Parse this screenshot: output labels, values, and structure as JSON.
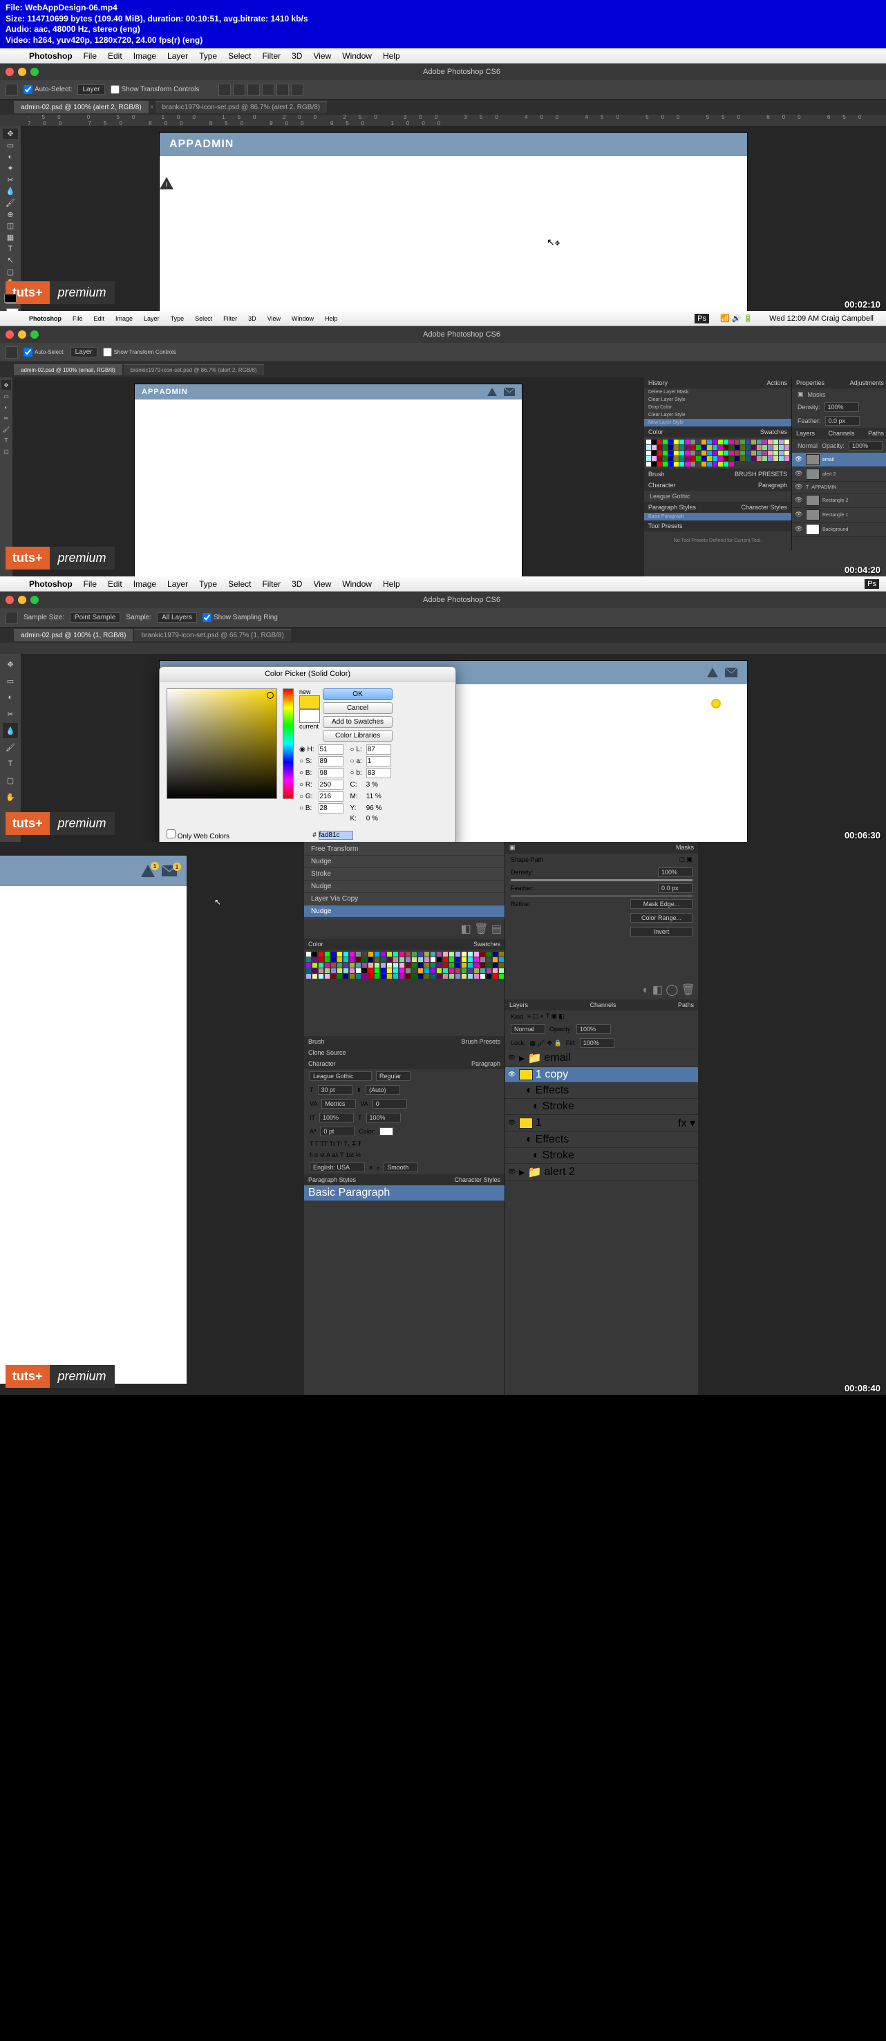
{
  "info": {
    "file": "File: WebAppDesign-06.mp4",
    "size": "Size: 114710699 bytes (109.40 MiB), duration: 00:10:51, avg.bitrate: 1410 kb/s",
    "audio": "Audio: aac, 48000 Hz, stereo (eng)",
    "video": "Video: h264, yuv420p, 1280x720, 24.00 fps(r) (eng)"
  },
  "menu": {
    "apple": "",
    "app": "Photoshop",
    "items": [
      "File",
      "Edit",
      "Image",
      "Layer",
      "Type",
      "Select",
      "Filter",
      "3D",
      "View",
      "Window",
      "Help"
    ],
    "status_right": "Wed 12:09 AM   Craig Campbell",
    "ps_badge": "Ps"
  },
  "title_bar": "Adobe Photoshop CS6",
  "options": {
    "auto_select": "Auto-Select:",
    "layer_sel": "Layer",
    "show_transform": "Show Transform Controls",
    "sample_size": "Sample Size:",
    "point_sample": "Point Sample",
    "sample": "Sample:",
    "all_layers": "All Layers",
    "show_ring": "Show Sampling Ring"
  },
  "tabs": {
    "t1_a": "admin-02.psd @ 100% (alert 2, RGB/8)",
    "t1_b": "brankic1979-icon-set.psd @ 86.7% (alert 2, RGB/8)",
    "t2_a": "admin-02.psd @ 100% (email, RGB/8)",
    "t2_b": "brankic1979-icon-set.psd @ 86.7% (alert 2, RGB/8)",
    "t3_a": "admin-02.psd @ 100% (1, RGB/8)",
    "t3_b": "brankic1979-icon-set.psd @ 66.7% (1, RGB/8)"
  },
  "app_header": {
    "logo_bold": "APP",
    "logo_thin": "ADMIN"
  },
  "color_picker": {
    "title": "Color Picker (Solid Color)",
    "ok": "OK",
    "cancel": "Cancel",
    "add_swatch": "Add to Swatches",
    "color_libs": "Color Libraries",
    "new": "new",
    "current": "current",
    "only_web": "Only Web Colors",
    "h": "51",
    "s": "89",
    "b": "98",
    "r": "250",
    "g": "216",
    "bb": "28",
    "l": "87",
    "a": "1",
    "bl": "83",
    "c": "3",
    "m": "11",
    "y": "96",
    "k": "0",
    "hex": "fad81c"
  },
  "panels": {
    "history": "History",
    "actions": "Actions",
    "swatches": "Swatches",
    "color": "Color",
    "character": "Character",
    "paragraph": "Paragraph",
    "par_styles": "Paragraph Styles",
    "char_styles": "Character Styles",
    "basic_par": "Basic Paragraph",
    "brush": "Brush",
    "brush_presets": "Brush Presets",
    "clone_src": "Clone Source",
    "properties": "Properties",
    "adjustments": "Adjustments",
    "layers": "Layers",
    "channels": "Channels",
    "paths": "Paths",
    "masks": "Masks",
    "shape_path": "Shape Path",
    "density": "Density:",
    "density_val": "100%",
    "feather": "Feather:",
    "feather_val": "0.0 px",
    "refine": "Refine:",
    "mask_edge": "Mask Edge...",
    "color_range": "Color Range...",
    "invert": "Invert",
    "normal": "Normal",
    "opacity": "Opacity:",
    "opacity_val": "100%",
    "lock": "Lock:",
    "fill": "Fill:",
    "fill_val": "100%",
    "kind": "Kind",
    "tool_presets": "Tool Presets",
    "no_presets": "No Tool Presets Defined for Current Tool.",
    "h_items": [
      "Delete Layer Mask",
      "Clear Layer Style",
      "Drop Color",
      "Clear Layer Style",
      "New Layer Style"
    ],
    "brush_preset_label": "BRUSH PRESETS",
    "league_gothic": "League Gothic",
    "regular": "Regular",
    "font_size": "30 pt",
    "auto": "(Auto)",
    "metrics": "Metrics",
    "zero": "0",
    "pct100": "100%",
    "pt0": "0 pt",
    "color_lbl": "Color:",
    "english": "English: USA",
    "smooth": "Smooth",
    "va": "VA"
  },
  "context": {
    "items": [
      "Free Transform",
      "Nudge",
      "Stroke",
      "Nudge",
      "Layer Via Copy",
      "Nudge"
    ]
  },
  "layers": {
    "email": "email",
    "one": "1",
    "one_copy": "1 copy",
    "effects": "Effects",
    "stroke": "Stroke",
    "alert2": "alert 2",
    "rect2": "Rectangle 2",
    "rect1": "Rectangle 1",
    "background": "Background",
    "appadmin": "APPADMIN",
    "t_label": "T"
  },
  "timestamps": {
    "s1": "00:02:10",
    "s2": "00:04:20",
    "s3": "00:06:30",
    "s4": "00:08:40"
  },
  "tuts": {
    "box": "tuts+",
    "prem": "premium"
  },
  "badge_count": "1"
}
